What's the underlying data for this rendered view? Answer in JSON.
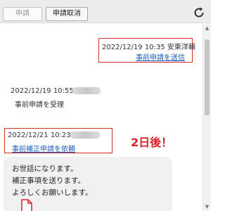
{
  "toolbar": {
    "apply_label": "申請",
    "cancel_label": "申請取消"
  },
  "messages": [
    {
      "timestamp": "2022/12/19 10:35",
      "sender": "安東洋輔",
      "link": "事前申請を送信"
    },
    {
      "timestamp": "2022/12/19 10:55",
      "text": "事前申請を受理"
    },
    {
      "timestamp": "2022/12/21 10:23",
      "link": "事前補正申請を依頼"
    }
  ],
  "annotation": "2日後！",
  "bubble": {
    "lines": [
      "お世話になります。",
      "補正事項を送ります。",
      "よろしくお願いします。"
    ]
  },
  "colors": {
    "highlight": "#d62b2b",
    "link": "#1f5fbf",
    "annotation": "#d8232a"
  }
}
